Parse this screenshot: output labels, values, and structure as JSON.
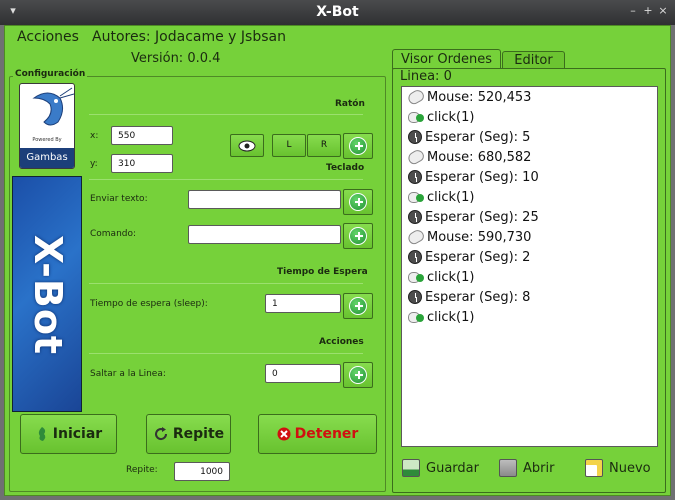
{
  "window": {
    "title": "X-Bot",
    "sys_buttons": [
      "▾",
      "–",
      "+",
      "×"
    ]
  },
  "menu": {
    "acciones": "Acciones",
    "autores": "Autores: Jodacame y Jsbsan"
  },
  "version": "Versión: 0.0.4",
  "config": {
    "legend": "Configuración",
    "gambas_powered": "Powered By",
    "gambas_name": "Gambas",
    "logo_text": "X-Bot",
    "raton_title": "Ratón",
    "x_label": "x:",
    "x_value": "550",
    "y_label": "y:",
    "y_value": "310",
    "left_btn": "L",
    "right_btn": "R",
    "teclado_title": "Teclado",
    "enviar_label": "Enviar texto:",
    "enviar_value": "",
    "comando_label": "Comando:",
    "comando_value": "",
    "espera_title": "Tiempo de Espera",
    "sleep_label": "Tiempo de espera (sleep):",
    "sleep_value": "1",
    "acciones_title": "Acciones",
    "saltar_label": "Saltar a la Linea:",
    "saltar_value": "0"
  },
  "actions": {
    "iniciar": "Iniciar",
    "repite": "Repite",
    "detener": "Detener",
    "repite_label": "Repite:",
    "repite_value": "1000"
  },
  "tabs": {
    "visor": "Visor Ordenes",
    "editor": "Editor"
  },
  "linea": "Linea: 0",
  "commands": [
    {
      "icon": "mouse-icon",
      "text": "Mouse: 520,453"
    },
    {
      "icon": "click-icon",
      "text": "click(1)"
    },
    {
      "icon": "clock-icon",
      "text": "Esperar (Seg): 5"
    },
    {
      "icon": "mouse-icon",
      "text": "Mouse: 680,582"
    },
    {
      "icon": "clock-icon",
      "text": "Esperar (Seg): 10"
    },
    {
      "icon": "click-icon",
      "text": "click(1)"
    },
    {
      "icon": "clock-icon",
      "text": "Esperar (Seg): 25"
    },
    {
      "icon": "mouse-icon",
      "text": "Mouse: 590,730"
    },
    {
      "icon": "clock-icon",
      "text": "Esperar (Seg): 2"
    },
    {
      "icon": "click-icon",
      "text": "click(1)"
    },
    {
      "icon": "clock-icon",
      "text": "Esperar (Seg): 8"
    },
    {
      "icon": "click-icon",
      "text": "click(1)"
    }
  ],
  "footer": {
    "guardar": "Guardar",
    "abrir": "Abrir",
    "nuevo": "Nuevo"
  },
  "colors": {
    "accent": "#76d13a",
    "danger": "#d01010"
  }
}
